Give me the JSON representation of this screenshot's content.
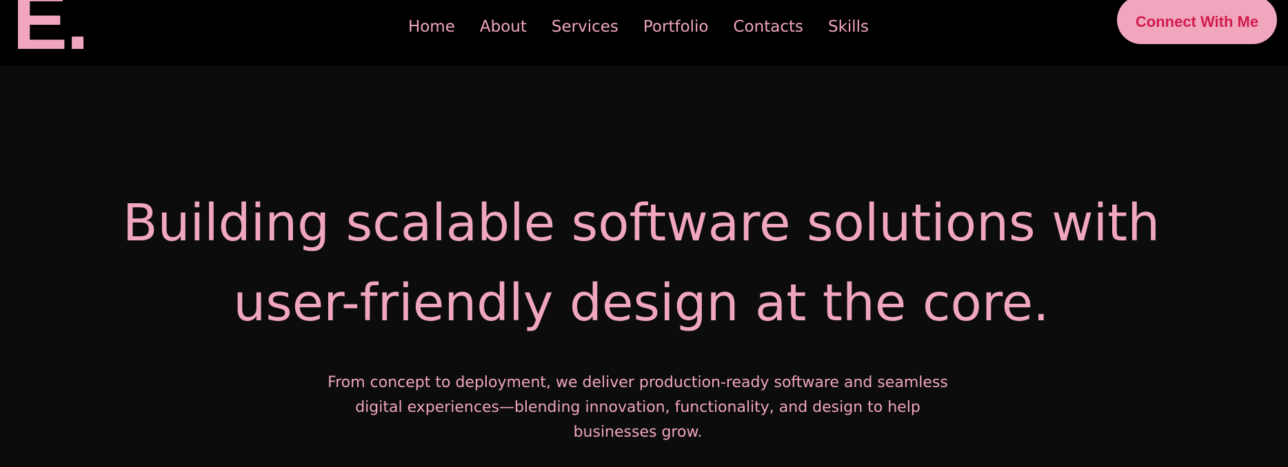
{
  "brand": {
    "logo_text": "E."
  },
  "nav": {
    "items": [
      {
        "label": "Home"
      },
      {
        "label": "About"
      },
      {
        "label": "Services"
      },
      {
        "label": "Portfolio"
      },
      {
        "label": "Contacts"
      },
      {
        "label": "Skills"
      }
    ],
    "cta_label": "Connect With Me"
  },
  "hero": {
    "title": "Building scalable software solutions with user-friendly design at the core.",
    "subtitle": "From concept to deployment, we deliver production-ready software and seamless digital experiences—blending innovation, functionality, and design to help businesses grow."
  },
  "colors": {
    "background": "#0c0c0b",
    "navbar": "#000000",
    "accent_pink": "#f0a6bd",
    "cta_text": "#d21b4c"
  }
}
